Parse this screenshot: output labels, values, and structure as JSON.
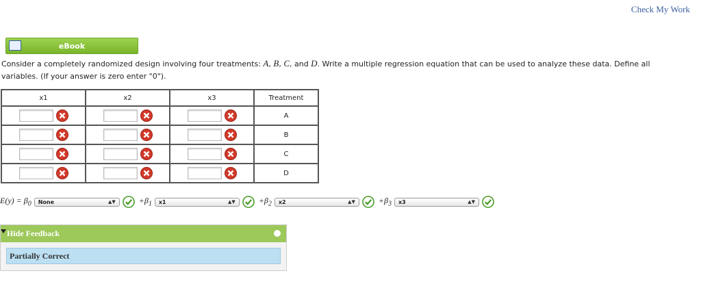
{
  "header": {
    "check_my_work": "Check My Work"
  },
  "ebook": {
    "label": "eBook"
  },
  "question": {
    "text_1": "Consider a completely randomized design involving four treatments: ",
    "var_a": "A",
    "sep_1": ", ",
    "var_b": "B",
    "sep_2": ", ",
    "var_c": "C",
    "sep_3": ", and ",
    "var_d": "D",
    "text_2": ". Write a multiple regression equation that can be used to analyze these data. Define all variables. (If your answer is zero enter \"0\")."
  },
  "table": {
    "headers": [
      "x1",
      "x2",
      "x3",
      "Treatment"
    ],
    "rows": [
      {
        "treatment": "A",
        "x1": "",
        "x2": "",
        "x3": ""
      },
      {
        "treatment": "B",
        "x1": "",
        "x2": "",
        "x3": ""
      },
      {
        "treatment": "C",
        "x1": "",
        "x2": "",
        "x3": ""
      },
      {
        "treatment": "D",
        "x1": "",
        "x2": "",
        "x3": ""
      }
    ],
    "status_icon": "x-circle-red"
  },
  "equation": {
    "prefix": "E(y) = β",
    "prefix_sub": "0",
    "terms": [
      {
        "plus": "+β",
        "sub": "1",
        "selected": "x1"
      },
      {
        "plus": "+β",
        "sub": "2",
        "selected": "x2"
      },
      {
        "plus": "+β",
        "sub": "3",
        "selected": "x3"
      }
    ],
    "beta0_selected": "None",
    "status_icon": "check-circle-green"
  },
  "feedback": {
    "toggle_label": "Hide Feedback",
    "status": "Partially Correct",
    "colors": {
      "header": "#9dc85a",
      "status_bg": "#bcdff2"
    }
  }
}
